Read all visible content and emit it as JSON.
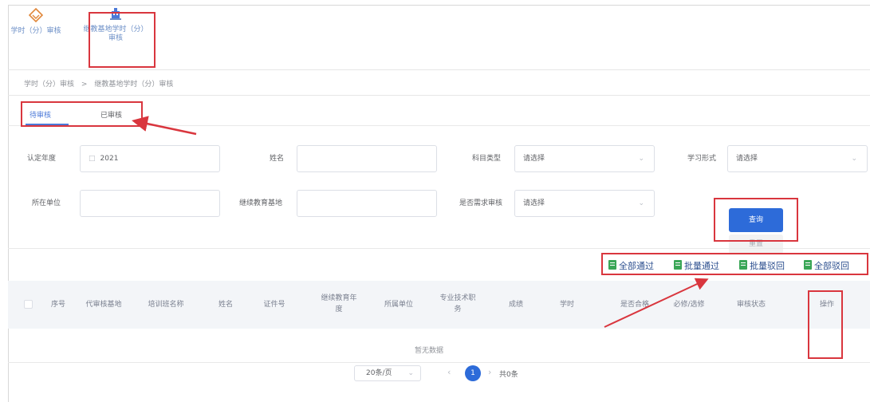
{
  "modules": [
    {
      "label": "学时（分）审核",
      "icon": "diamond-icon"
    },
    {
      "label": "继教基地学时（分）审核",
      "icon": "building-icon"
    }
  ],
  "breadcrumb": [
    "学时（分）审核",
    ">",
    "继教基地学时（分）审核"
  ],
  "tabs": [
    "待审核",
    "已审核"
  ],
  "form": {
    "year": {
      "label": "认定年度",
      "value": "2021"
    },
    "name": {
      "label": "姓名",
      "value": ""
    },
    "subject_type": {
      "label": "科目类型",
      "value": "请选择"
    },
    "study_form": {
      "label": "学习形式",
      "value": "请选择"
    },
    "unit": {
      "label": "所在单位",
      "value": ""
    },
    "base": {
      "label": "继续教育基地",
      "value": ""
    },
    "is_audited": {
      "label": "是否需求审核",
      "value": "请选择"
    }
  },
  "buttons": {
    "query": "查询",
    "reset": "重置"
  },
  "actions": [
    "全部通过",
    "批量通过",
    "批量驳回",
    "全部驳回"
  ],
  "table": {
    "headers": [
      "序号",
      "代审核基地",
      "培训班名称",
      "姓名",
      "证件号",
      "继续教育年度",
      "所属单位",
      "专业技术职务",
      "成绩",
      "学时",
      "是否合格",
      "必修/选修",
      "审核状态",
      "操作"
    ],
    "empty_text": "暂无数据"
  },
  "pagination": {
    "page_size": "20条/页",
    "current_page": "1",
    "total": "共0条"
  },
  "colors": {
    "accent": "#2d6bd9",
    "annotation": "#d9363e",
    "action_icon": "#3aa657"
  }
}
